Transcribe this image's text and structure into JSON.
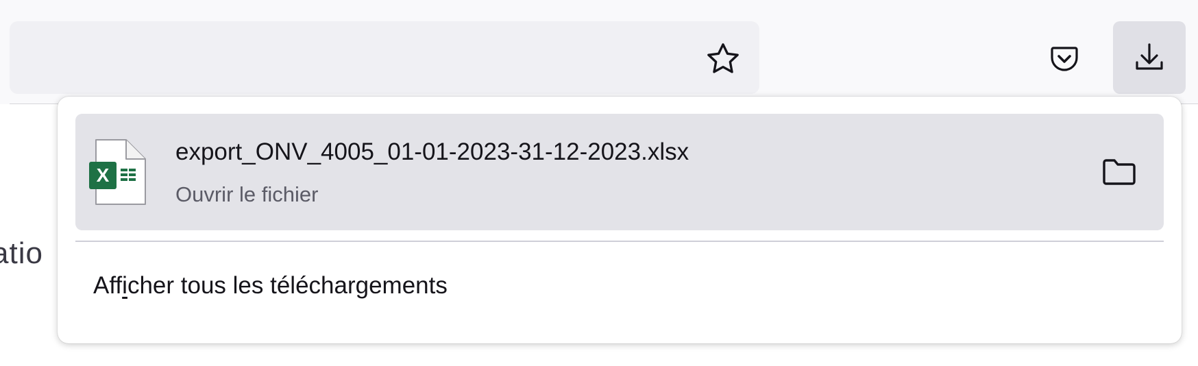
{
  "toolbar": {
    "star_icon": "star-outline-icon",
    "pocket_icon": "pocket-icon",
    "download_icon": "download-arrow-icon"
  },
  "page": {
    "partial_text": "atio"
  },
  "downloads_panel": {
    "items": [
      {
        "file_name": "export_ONV_4005_01-01-2023-31-12-2023.xlsx",
        "status": "Ouvrir le fichier",
        "file_icon": "excel-file-icon",
        "action_icon": "folder-icon",
        "excel_badge_letter": "X"
      }
    ],
    "show_all_label": {
      "before_access_key": "Aff",
      "access_key": "i",
      "after_access_key": "cher tous les téléchargements"
    }
  },
  "colors": {
    "toolbar_bg": "#f9f9fb",
    "urlbar_bg": "#f0f0f4",
    "download_button_bg": "#e0e0e6",
    "item_highlight_bg": "#e3e3e8",
    "excel_green": "#1e7145",
    "text_primary": "#15141a",
    "text_secondary": "#5b5b66"
  }
}
